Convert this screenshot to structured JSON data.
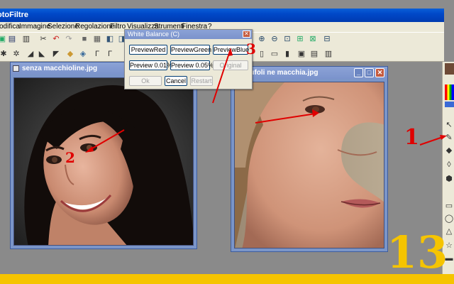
{
  "app": {
    "title": "otoFiltre"
  },
  "menu": [
    "odifica",
    "Immagine",
    "Selezione",
    "Regolazione",
    "Filtro",
    "Visualizza",
    "Strumenti",
    "Finestra",
    "?"
  ],
  "documents": {
    "left": {
      "title": "senza macchioline.jpg"
    },
    "right": {
      "title": "za brufoli ne macchia.jpg"
    }
  },
  "dialog": {
    "title": "White Balance (C)",
    "buttons": {
      "preview_red": "PreviewRed",
      "preview_green": "PreviewGreen",
      "preview_blue": "PreviewBlue",
      "preview_001": "Preview 0.01%",
      "preview_005": "Preview 0.05%",
      "original": "Original",
      "ok": "Ok",
      "cancel": "Cancel",
      "restart": "Restart"
    }
  },
  "annotations": {
    "n1": "1",
    "n2": "2",
    "n3": "3",
    "step": "13"
  },
  "colors": {
    "frame": "#f5c400",
    "titlebar": "#0048c8",
    "annotation": "#e00000"
  },
  "icons": [
    "save-icon",
    "undo-icon",
    "redo-icon",
    "zoom-in-icon",
    "zoom-out-icon",
    "select-arrow-icon",
    "pencil-icon",
    "fill-icon",
    "dropper-icon",
    "rectangle-icon",
    "ellipse-icon",
    "triangle-icon"
  ]
}
